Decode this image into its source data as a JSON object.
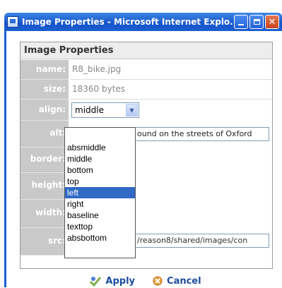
{
  "window": {
    "title": "Image Properties - Microsoft Internet Explo...",
    "buttons": [
      "minimize",
      "maximize",
      "close"
    ]
  },
  "panel": {
    "header": "Image Properties",
    "fields": {
      "name": {
        "label": "name:",
        "value": "R8_bike.jpg"
      },
      "size": {
        "label": "size:",
        "value": "18360 bytes"
      },
      "align": {
        "label": "align:",
        "selected": "middle",
        "options": [
          "absmiddle",
          "middle",
          "bottom",
          "top",
          "left",
          "right",
          "baseline",
          "texttop",
          "absbottom"
        ],
        "highlighted": "left"
      },
      "alt": {
        "label": "alt:",
        "value": "ound on the streets of Oxford"
      },
      "border": {
        "label": "border:"
      },
      "height": {
        "label": "height:"
      },
      "width": {
        "label": "width:"
      },
      "src": {
        "label": "src:",
        "value": "/reason8/shared/images/con"
      }
    }
  },
  "footer": {
    "apply_label": "Apply",
    "cancel_label": "Cancel"
  },
  "colors": {
    "titlebar": "#1654c9",
    "label_bg": "#c9c9c9",
    "selection": "#316ac5",
    "link": "#1c4c9c"
  }
}
